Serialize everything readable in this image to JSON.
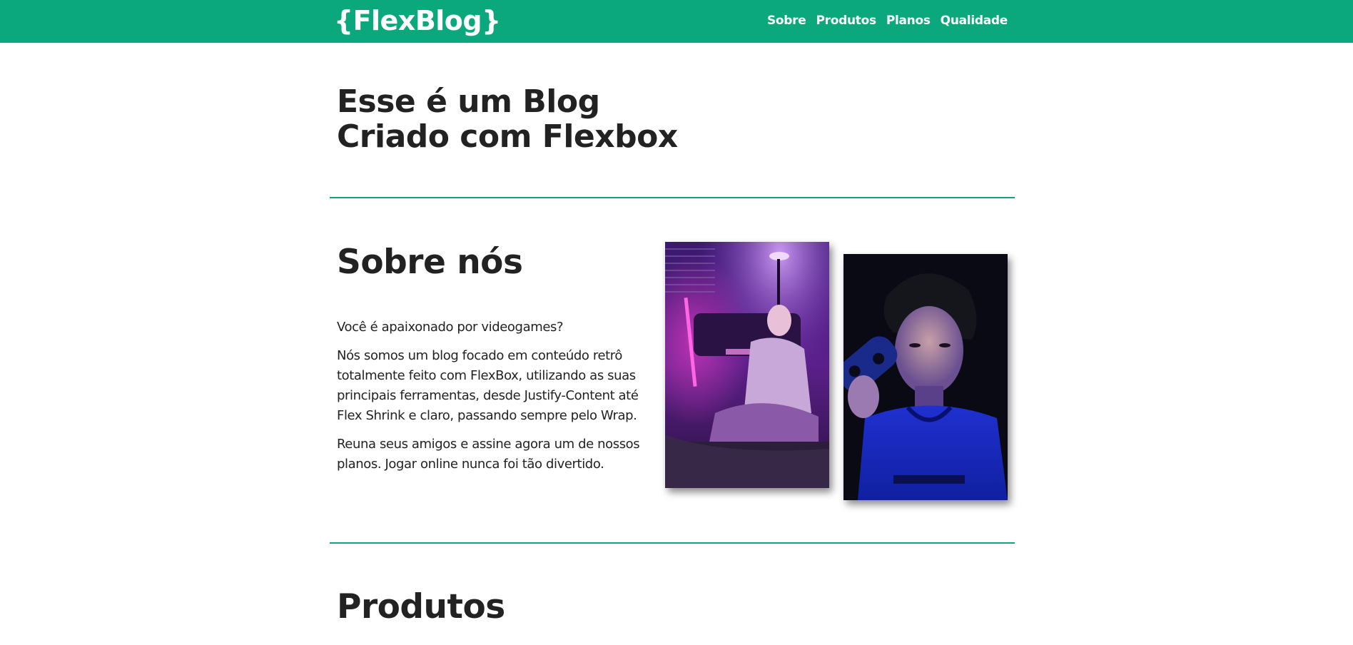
{
  "header": {
    "logo": "{FlexBlog}",
    "nav": [
      {
        "label": "Sobre"
      },
      {
        "label": "Produtos"
      },
      {
        "label": "Planos"
      },
      {
        "label": "Qualidade"
      }
    ]
  },
  "hero": {
    "title_line1": "Esse é um Blog",
    "title_line2": "Criado com Flexbox"
  },
  "about": {
    "title": "Sobre nós",
    "paragraphs": [
      "Você é apaixonado por videogames?",
      "Nós somos um blog focado em conteúdo retrô totalmente feito com FlexBox, utilizando as suas principais ferramentas, desde Justify-Content até Flex Shrink e claro, passando sempre pelo Wrap.",
      "Reuna seus amigos e assine agora um de nossos planos. Jogar online nunca foi tão divertido."
    ]
  },
  "products": {
    "title": "Produtos"
  },
  "colors": {
    "brand": "#0aa87c",
    "text": "#222222",
    "background": "#ffffff"
  }
}
